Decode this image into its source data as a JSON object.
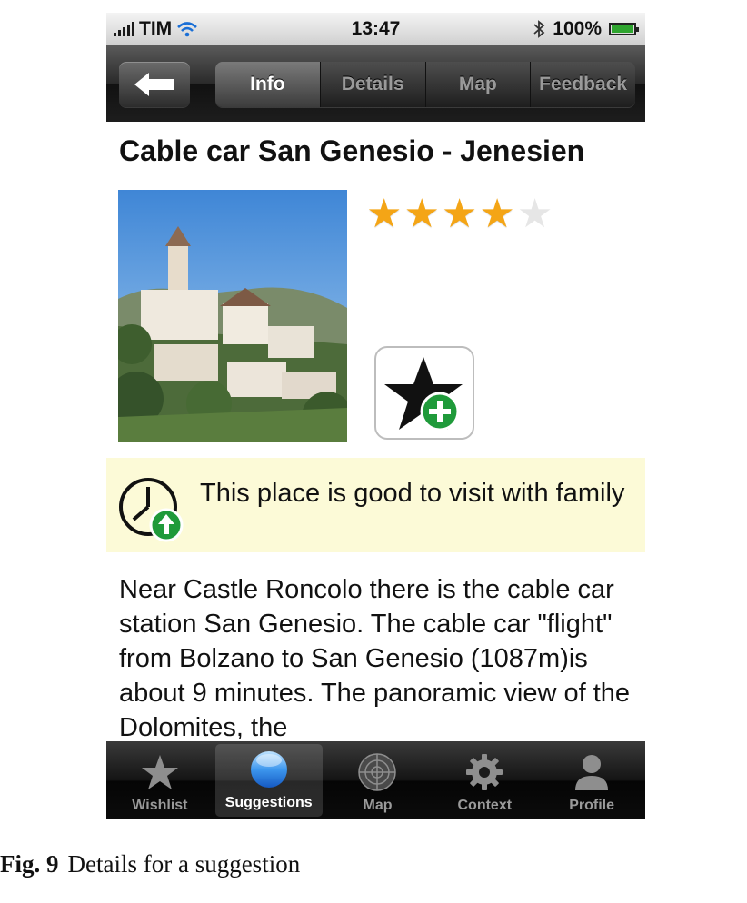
{
  "status_bar": {
    "carrier": "TIM",
    "time": "13:47",
    "battery": "100%",
    "icons": [
      "signal-icon",
      "wifi-icon",
      "bluetooth-icon",
      "battery-icon"
    ]
  },
  "nav": {
    "back_icon": "back-arrow-icon",
    "tabs": [
      {
        "label": "Info",
        "active": true
      },
      {
        "label": "Details",
        "active": false
      },
      {
        "label": "Map",
        "active": false
      },
      {
        "label": "Feedback",
        "active": false
      }
    ]
  },
  "place": {
    "title": "Cable car San Genesio - Jenesien",
    "rating": 4,
    "rating_max": 5,
    "wishlist_icon": "star-add-icon",
    "notice": "This place is good to visit with family",
    "notice_icon": "clock-up-icon",
    "description": "Near Castle Roncolo there is the cable car station San Genesio. The cable car \"flight\" from Bolzano to San Genesio (1087m)is about 9 minutes. The panoramic view of the Dolomites, the"
  },
  "tab_bar": {
    "items": [
      {
        "label": "Wishlist",
        "icon": "star-icon",
        "active": false
      },
      {
        "label": "Suggestions",
        "icon": "globe-icon",
        "active": true
      },
      {
        "label": "Map",
        "icon": "radar-icon",
        "active": false
      },
      {
        "label": "Context",
        "icon": "gear-icon",
        "active": false
      },
      {
        "label": "Profile",
        "icon": "person-icon",
        "active": false
      }
    ]
  },
  "caption": {
    "fig": "Fig. 9",
    "text": "Details for a suggestion"
  },
  "colors": {
    "star_on": "#f4a516",
    "star_off": "#e6e6e6",
    "notice_bg": "#fcfad7",
    "badge_green": "#1f9a3a"
  }
}
